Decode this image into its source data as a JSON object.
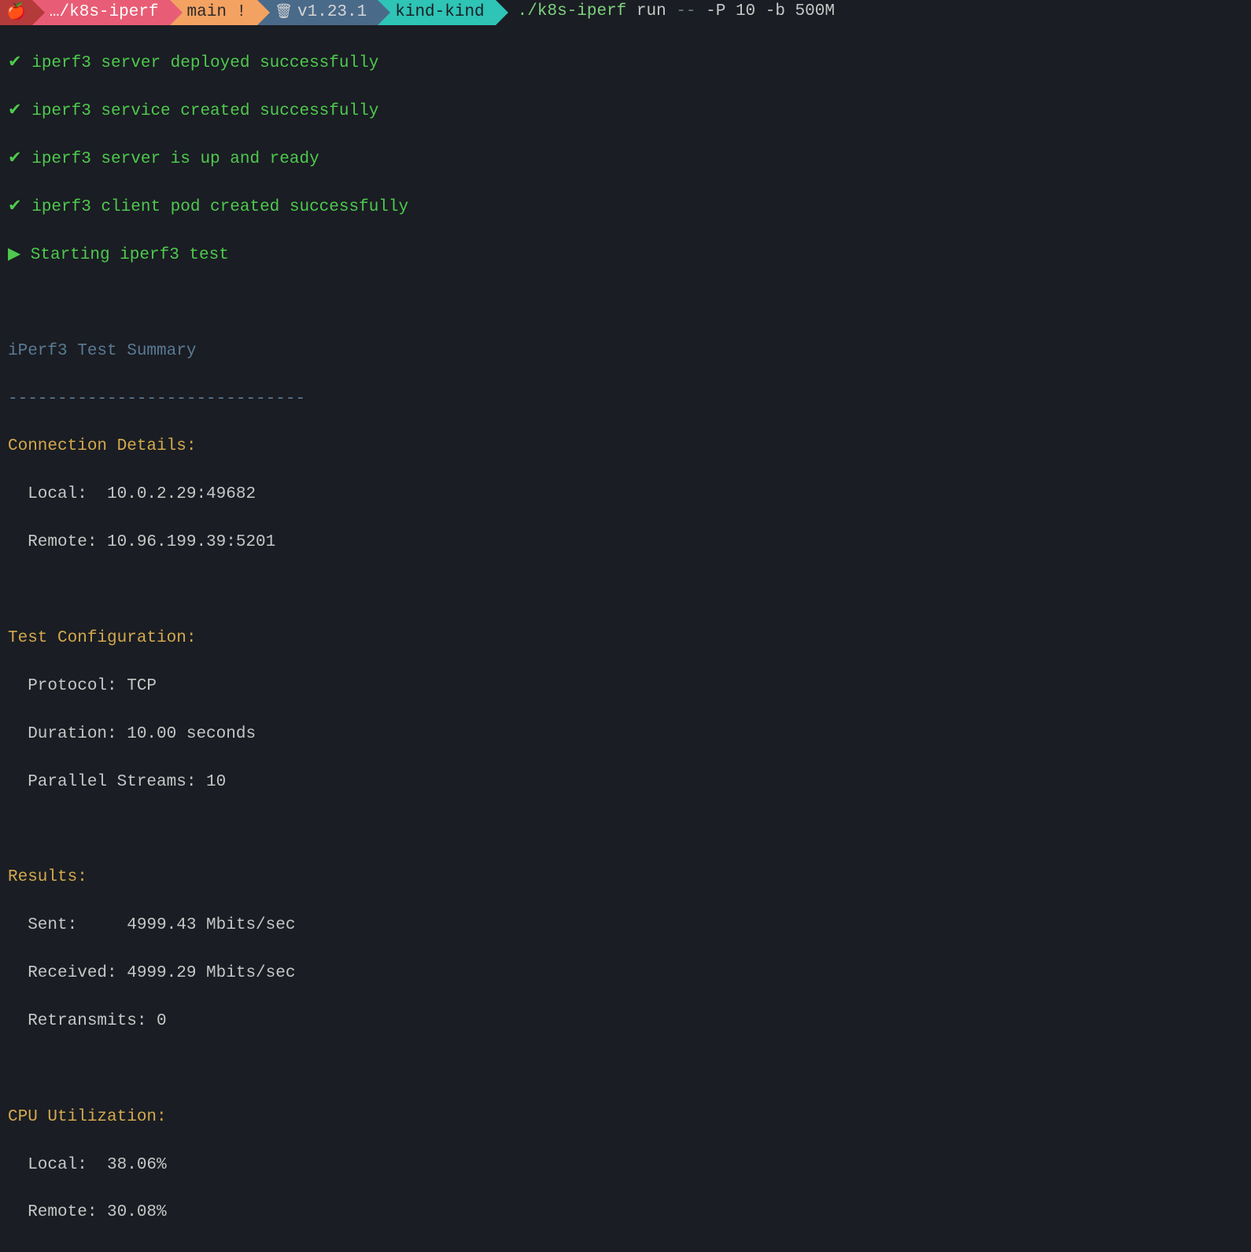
{
  "prompt": {
    "apple": "🍎",
    "path": "…/k8s-iperf",
    "branch": "main !",
    "trash": "🗑",
    "k8s_version": "v1.23.1",
    "context": "kind-kind",
    "cmd_bin": "./k8s-iperf",
    "cmd_sub": "run",
    "cmd_dash": "--",
    "cmd_args": "-P 10 -b 500M"
  },
  "status_lines": [
    {
      "icon": "✔",
      "text": "iperf3 server deployed successfully"
    },
    {
      "icon": "✔",
      "text": "iperf3 service created successfully"
    },
    {
      "icon": "✔",
      "text": "iperf3 server is up and ready"
    },
    {
      "icon": "✔",
      "text": "iperf3 client pod created successfully"
    },
    {
      "icon": "▶",
      "text": "Starting iperf3 test"
    }
  ],
  "summary": {
    "title": "iPerf3 Test Summary",
    "divider": "------------------------------",
    "conn_heading": "Connection Details:",
    "conn_local": "  Local:  10.0.2.29:49682",
    "conn_remote": "  Remote: 10.96.199.39:5201",
    "cfg_heading": "Test Configuration:",
    "cfg_proto": "  Protocol: TCP",
    "cfg_dur": "  Duration: 10.00 seconds",
    "cfg_streams": "  Parallel Streams: 10",
    "res_heading": "Results:",
    "res_sent": "  Sent:     4999.43 Mbits/sec",
    "res_recv": "  Received: 4999.29 Mbits/sec",
    "res_retr": "  Retransmits: 0",
    "cpu_heading": "CPU Utilization:",
    "cpu_local": "  Local:  38.06%",
    "cpu_remote": "  Remote: 30.08%"
  }
}
